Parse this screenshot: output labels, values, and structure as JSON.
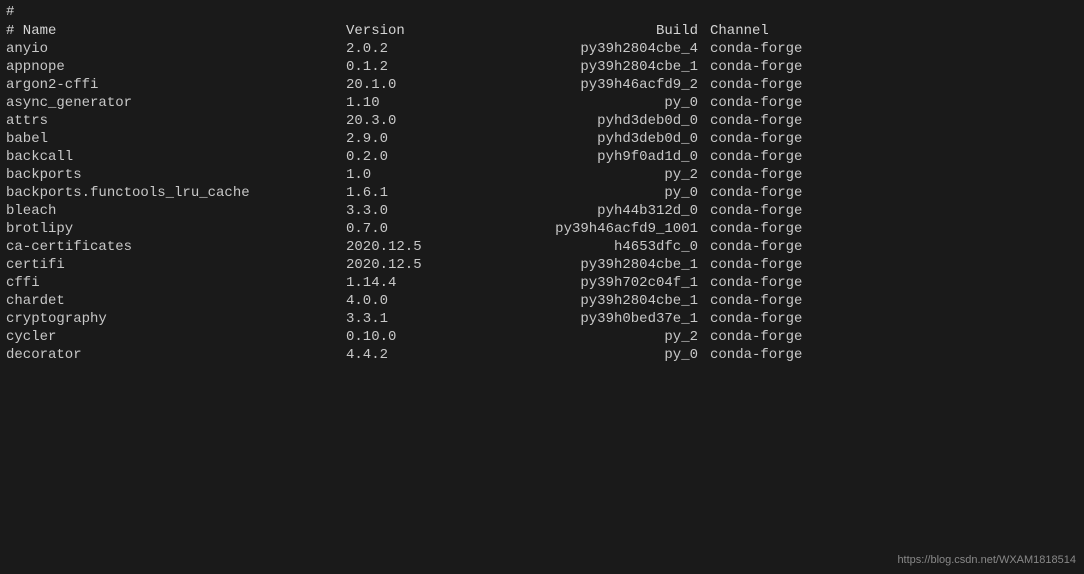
{
  "terminal": {
    "hash_line": "#",
    "columns": {
      "name": "# Name",
      "version": "Version",
      "build": "Build",
      "channel": "Channel"
    },
    "rows": [
      {
        "name": "anyio",
        "version": "2.0.2",
        "build": "py39h2804cbe_4",
        "channel": "conda-forge"
      },
      {
        "name": "appnope",
        "version": "0.1.2",
        "build": "py39h2804cbe_1",
        "channel": "conda-forge"
      },
      {
        "name": "argon2-cffi",
        "version": "20.1.0",
        "build": "py39h46acfd9_2",
        "channel": "conda-forge"
      },
      {
        "name": "async_generator",
        "version": "1.10",
        "build": "py_0",
        "channel": "conda-forge"
      },
      {
        "name": "attrs",
        "version": "20.3.0",
        "build": "pyhd3deb0d_0",
        "channel": "conda-forge"
      },
      {
        "name": "babel",
        "version": "2.9.0",
        "build": "pyhd3deb0d_0",
        "channel": "conda-forge"
      },
      {
        "name": "backcall",
        "version": "0.2.0",
        "build": "pyh9f0ad1d_0",
        "channel": "conda-forge"
      },
      {
        "name": "backports",
        "version": "1.0",
        "build": "py_2",
        "channel": "conda-forge"
      },
      {
        "name": "backports.functools_lru_cache",
        "version": "1.6.1",
        "build": "py_0",
        "channel": "conda-forge"
      },
      {
        "name": "bleach",
        "version": "3.3.0",
        "build": "pyh44b312d_0",
        "channel": "conda-forge"
      },
      {
        "name": "brotlipy",
        "version": "0.7.0",
        "build": "py39h46acfd9_1001",
        "channel": "conda-forge"
      },
      {
        "name": "ca-certificates",
        "version": "2020.12.5",
        "build": "h4653dfc_0",
        "channel": "conda-forge"
      },
      {
        "name": "certifi",
        "version": "2020.12.5",
        "build": "py39h2804cbe_1",
        "channel": "conda-forge"
      },
      {
        "name": "cffi",
        "version": "1.14.4",
        "build": "py39h702c04f_1",
        "channel": "conda-forge"
      },
      {
        "name": "chardet",
        "version": "4.0.0",
        "build": "py39h2804cbe_1",
        "channel": "conda-forge"
      },
      {
        "name": "cryptography",
        "version": "3.3.1",
        "build": "py39h0bed37e_1",
        "channel": "conda-forge"
      },
      {
        "name": "cycler",
        "version": "0.10.0",
        "build": "py_2",
        "channel": "conda-forge"
      },
      {
        "name": "decorator",
        "version": "4.4.2",
        "build": "py_0",
        "channel": "conda-forge"
      }
    ],
    "watermark": "https://blog.csdn.net/WXAM1818514"
  }
}
